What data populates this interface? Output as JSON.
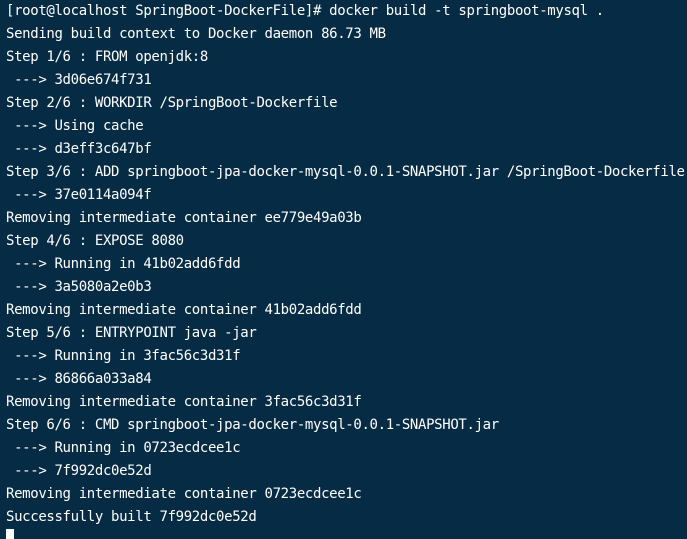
{
  "terminal": {
    "prompt": "[root@localhost SpringBoot-DockerFile]# ",
    "command": "docker build -t springboot-mysql .",
    "output": [
      "Sending build context to Docker daemon 86.73 MB",
      "Step 1/6 : FROM openjdk:8",
      " ---> 3d06e674f731",
      "Step 2/6 : WORKDIR /SpringBoot-Dockerfile",
      " ---> Using cache",
      " ---> d3eff3c647bf",
      "Step 3/6 : ADD springboot-jpa-docker-mysql-0.0.1-SNAPSHOT.jar /SpringBoot-Dockerfile",
      " ---> 37e0114a094f",
      "Removing intermediate container ee779e49a03b",
      "Step 4/6 : EXPOSE 8080",
      " ---> Running in 41b02add6fdd",
      " ---> 3a5080a2e0b3",
      "Removing intermediate container 41b02add6fdd",
      "Step 5/6 : ENTRYPOINT java -jar",
      " ---> Running in 3fac56c3d31f",
      " ---> 86866a033a84",
      "Removing intermediate container 3fac56c3d31f",
      "Step 6/6 : CMD springboot-jpa-docker-mysql-0.0.1-SNAPSHOT.jar",
      " ---> Running in 0723ecdcee1c",
      " ---> 7f992dc0e52d",
      "Removing intermediate container 0723ecdcee1c",
      "Successfully built 7f992dc0e52d"
    ]
  },
  "colors": {
    "background": "#062b45",
    "foreground": "#ffffff"
  }
}
